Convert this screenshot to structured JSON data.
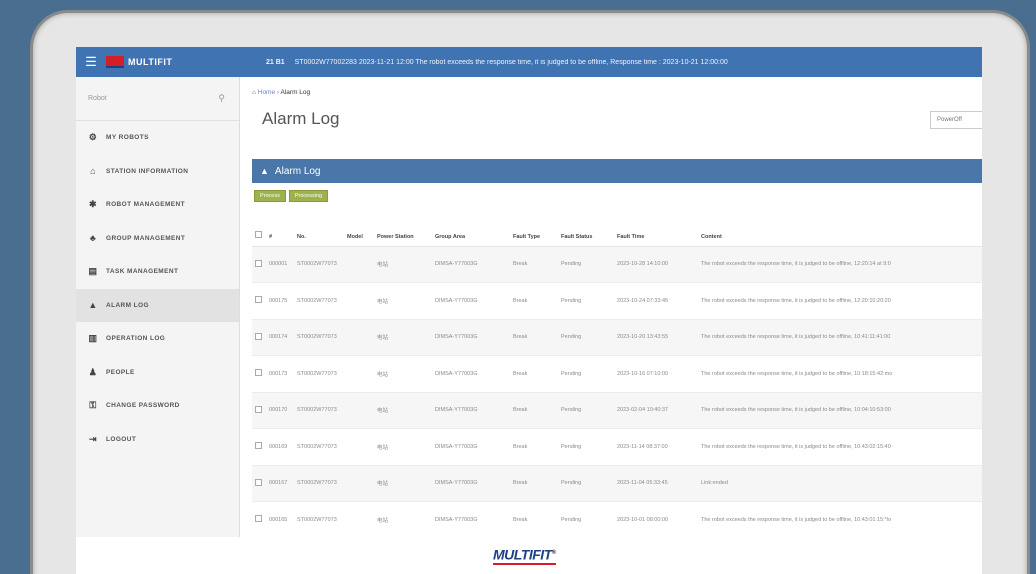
{
  "topbar": {
    "menu_icon": "hamburger-icon",
    "logo_text": "MULTIFIT",
    "notice_label": "21 B1",
    "notice_text": "ST0002W77002283 2023-11-21 12:00 The robot exceeds the response time, it is judged to be offline, Response time : 2023-10-21 12:00:00"
  },
  "sidebar": {
    "search_placeholder": "Robot",
    "search_icon": "search-icon",
    "items": [
      {
        "icon": "robot-icon",
        "label": "MY ROBOTS",
        "glyph": "⚙"
      },
      {
        "icon": "station-icon",
        "label": "STATION INFORMATION",
        "glyph": "⌂"
      },
      {
        "icon": "gear-icon",
        "label": "ROBOT MANAGEMENT",
        "glyph": "✱"
      },
      {
        "icon": "group-icon",
        "label": "GROUP MANAGEMENT",
        "glyph": "♣"
      },
      {
        "icon": "task-icon",
        "label": "TASK MANAGEMENT",
        "glyph": "▤"
      },
      {
        "icon": "alarm-icon",
        "label": "ALARM LOG",
        "glyph": "▲"
      },
      {
        "icon": "operation-icon",
        "label": "OPERATION LOG",
        "glyph": "▥"
      },
      {
        "icon": "people-icon",
        "label": "PEOPLE",
        "glyph": "♟"
      },
      {
        "icon": "key-icon",
        "label": "CHANGE PASSWORD",
        "glyph": "⚿"
      },
      {
        "icon": "logout-icon",
        "label": "LOGOUT",
        "glyph": "⇥"
      }
    ],
    "active_index": 5
  },
  "main": {
    "breadcrumb_home": "Home",
    "breadcrumb_current": "Alarm Log",
    "page_title": "Alarm Log",
    "top_right_button": "PowerOff",
    "panel_title": "Alarm Log",
    "buttons": [
      "Process",
      "Processing"
    ],
    "columns": [
      "#",
      "No.",
      "Model",
      "Power Station",
      "Group Area",
      "Fault Type",
      "Fault Status",
      "Fault Time",
      "Content"
    ],
    "rows": [
      {
        "id": "000001",
        "no": "ST0002W77073",
        "model": "",
        "station": "电站",
        "group": "DIMSA-Y77003G",
        "type": "Break",
        "status": "Pending",
        "time": "2023-10-28 14:10:00",
        "content": "The robot exceeds the response time, it is judged to be offline, 12:20:14 at 9:0"
      },
      {
        "id": "000175",
        "no": "ST0002W77073",
        "model": "",
        "station": "电站",
        "group": "DIMSA-Y77003G",
        "type": "Break",
        "status": "Pending",
        "time": "2023-10-24 07:33:45",
        "content": "The robot exceeds the response time, it is judged to be offline, 12:20:10:20:20"
      },
      {
        "id": "000174",
        "no": "ST0002W77073",
        "model": "",
        "station": "电站",
        "group": "DIMSA-Y77003G",
        "type": "Break",
        "status": "Pending",
        "time": "2023-10-20 13:43:55",
        "content": "The robot exceeds the response time, it is judged to be offline, 10:41:11:41:00"
      },
      {
        "id": "000173",
        "no": "ST0002W77073",
        "model": "",
        "station": "电站",
        "group": "DIMSA-Y77003G",
        "type": "Break",
        "status": "Pending",
        "time": "2023-10-16 07:10:00",
        "content": "The robot exceeds the response time, it is judged to be offline, 10:18:15:42:mo"
      },
      {
        "id": "000170",
        "no": "ST0002W77073",
        "model": "",
        "station": "电站",
        "group": "DIMSA-Y77003G",
        "type": "Break",
        "status": "Pending",
        "time": "2023-02-04 10:40:37",
        "content": "The robot exceeds the response time, it is judged to be offline, 10:04:10:53:00"
      },
      {
        "id": "000169",
        "no": "ST0002W77073",
        "model": "",
        "station": "电站",
        "group": "DIMSA-Y77003G",
        "type": "Break",
        "status": "Pending",
        "time": "2023-11-14 08:37:00",
        "content": "The robot exceeds the response time, it is judged to be offline, 10:43:02:15:40"
      },
      {
        "id": "000167",
        "no": "ST0002W77073",
        "model": "",
        "station": "电站",
        "group": "DIMSA-Y77003G",
        "type": "Break",
        "status": "Pending",
        "time": "2023-11-04 05:33:45",
        "content": "Link:ended"
      },
      {
        "id": "000165",
        "no": "ST0002W77073",
        "model": "",
        "station": "电站",
        "group": "DIMSA-Y77003G",
        "type": "Break",
        "status": "Pending",
        "time": "2023-10-01 08:00:00",
        "content": "The robot exceeds the response time, it is judged to be offline, 10:43:01:15:*lo"
      }
    ]
  },
  "footer": {
    "logo_text": "MULTIFIT",
    "registered": "®"
  }
}
